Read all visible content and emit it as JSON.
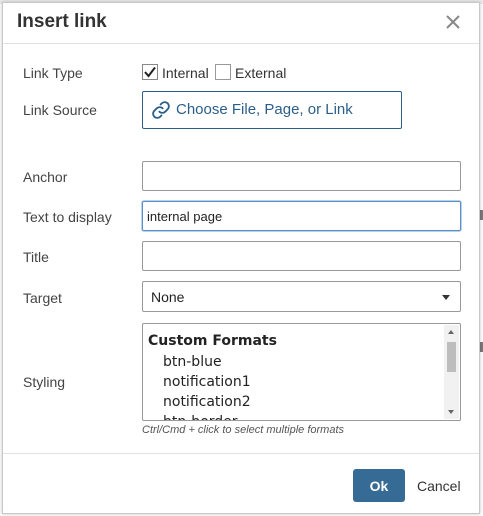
{
  "dialog": {
    "title": "Insert link",
    "close_icon": "close-icon"
  },
  "link_type": {
    "label": "Link Type",
    "options": [
      {
        "label": "Internal",
        "checked": true
      },
      {
        "label": "External",
        "checked": false
      }
    ]
  },
  "link_source": {
    "label": "Link Source",
    "button_label": "Choose File, Page, or Link",
    "icon": "link-icon",
    "accent": "#2b5f8a"
  },
  "anchor": {
    "label": "Anchor",
    "value": ""
  },
  "text_to_display": {
    "label": "Text to display",
    "value": "internal page"
  },
  "title_field": {
    "label": "Title",
    "value": ""
  },
  "target": {
    "label": "Target",
    "selected": "None"
  },
  "styling": {
    "label": "Styling",
    "group": "Custom Formats",
    "options": [
      "btn-blue",
      "notification1",
      "notification2",
      "btn-border"
    ],
    "hint": "Ctrl/Cmd + click to select multiple formats"
  },
  "footer": {
    "ok_label": "Ok",
    "cancel_label": "Cancel",
    "ok_color": "#356b94"
  }
}
